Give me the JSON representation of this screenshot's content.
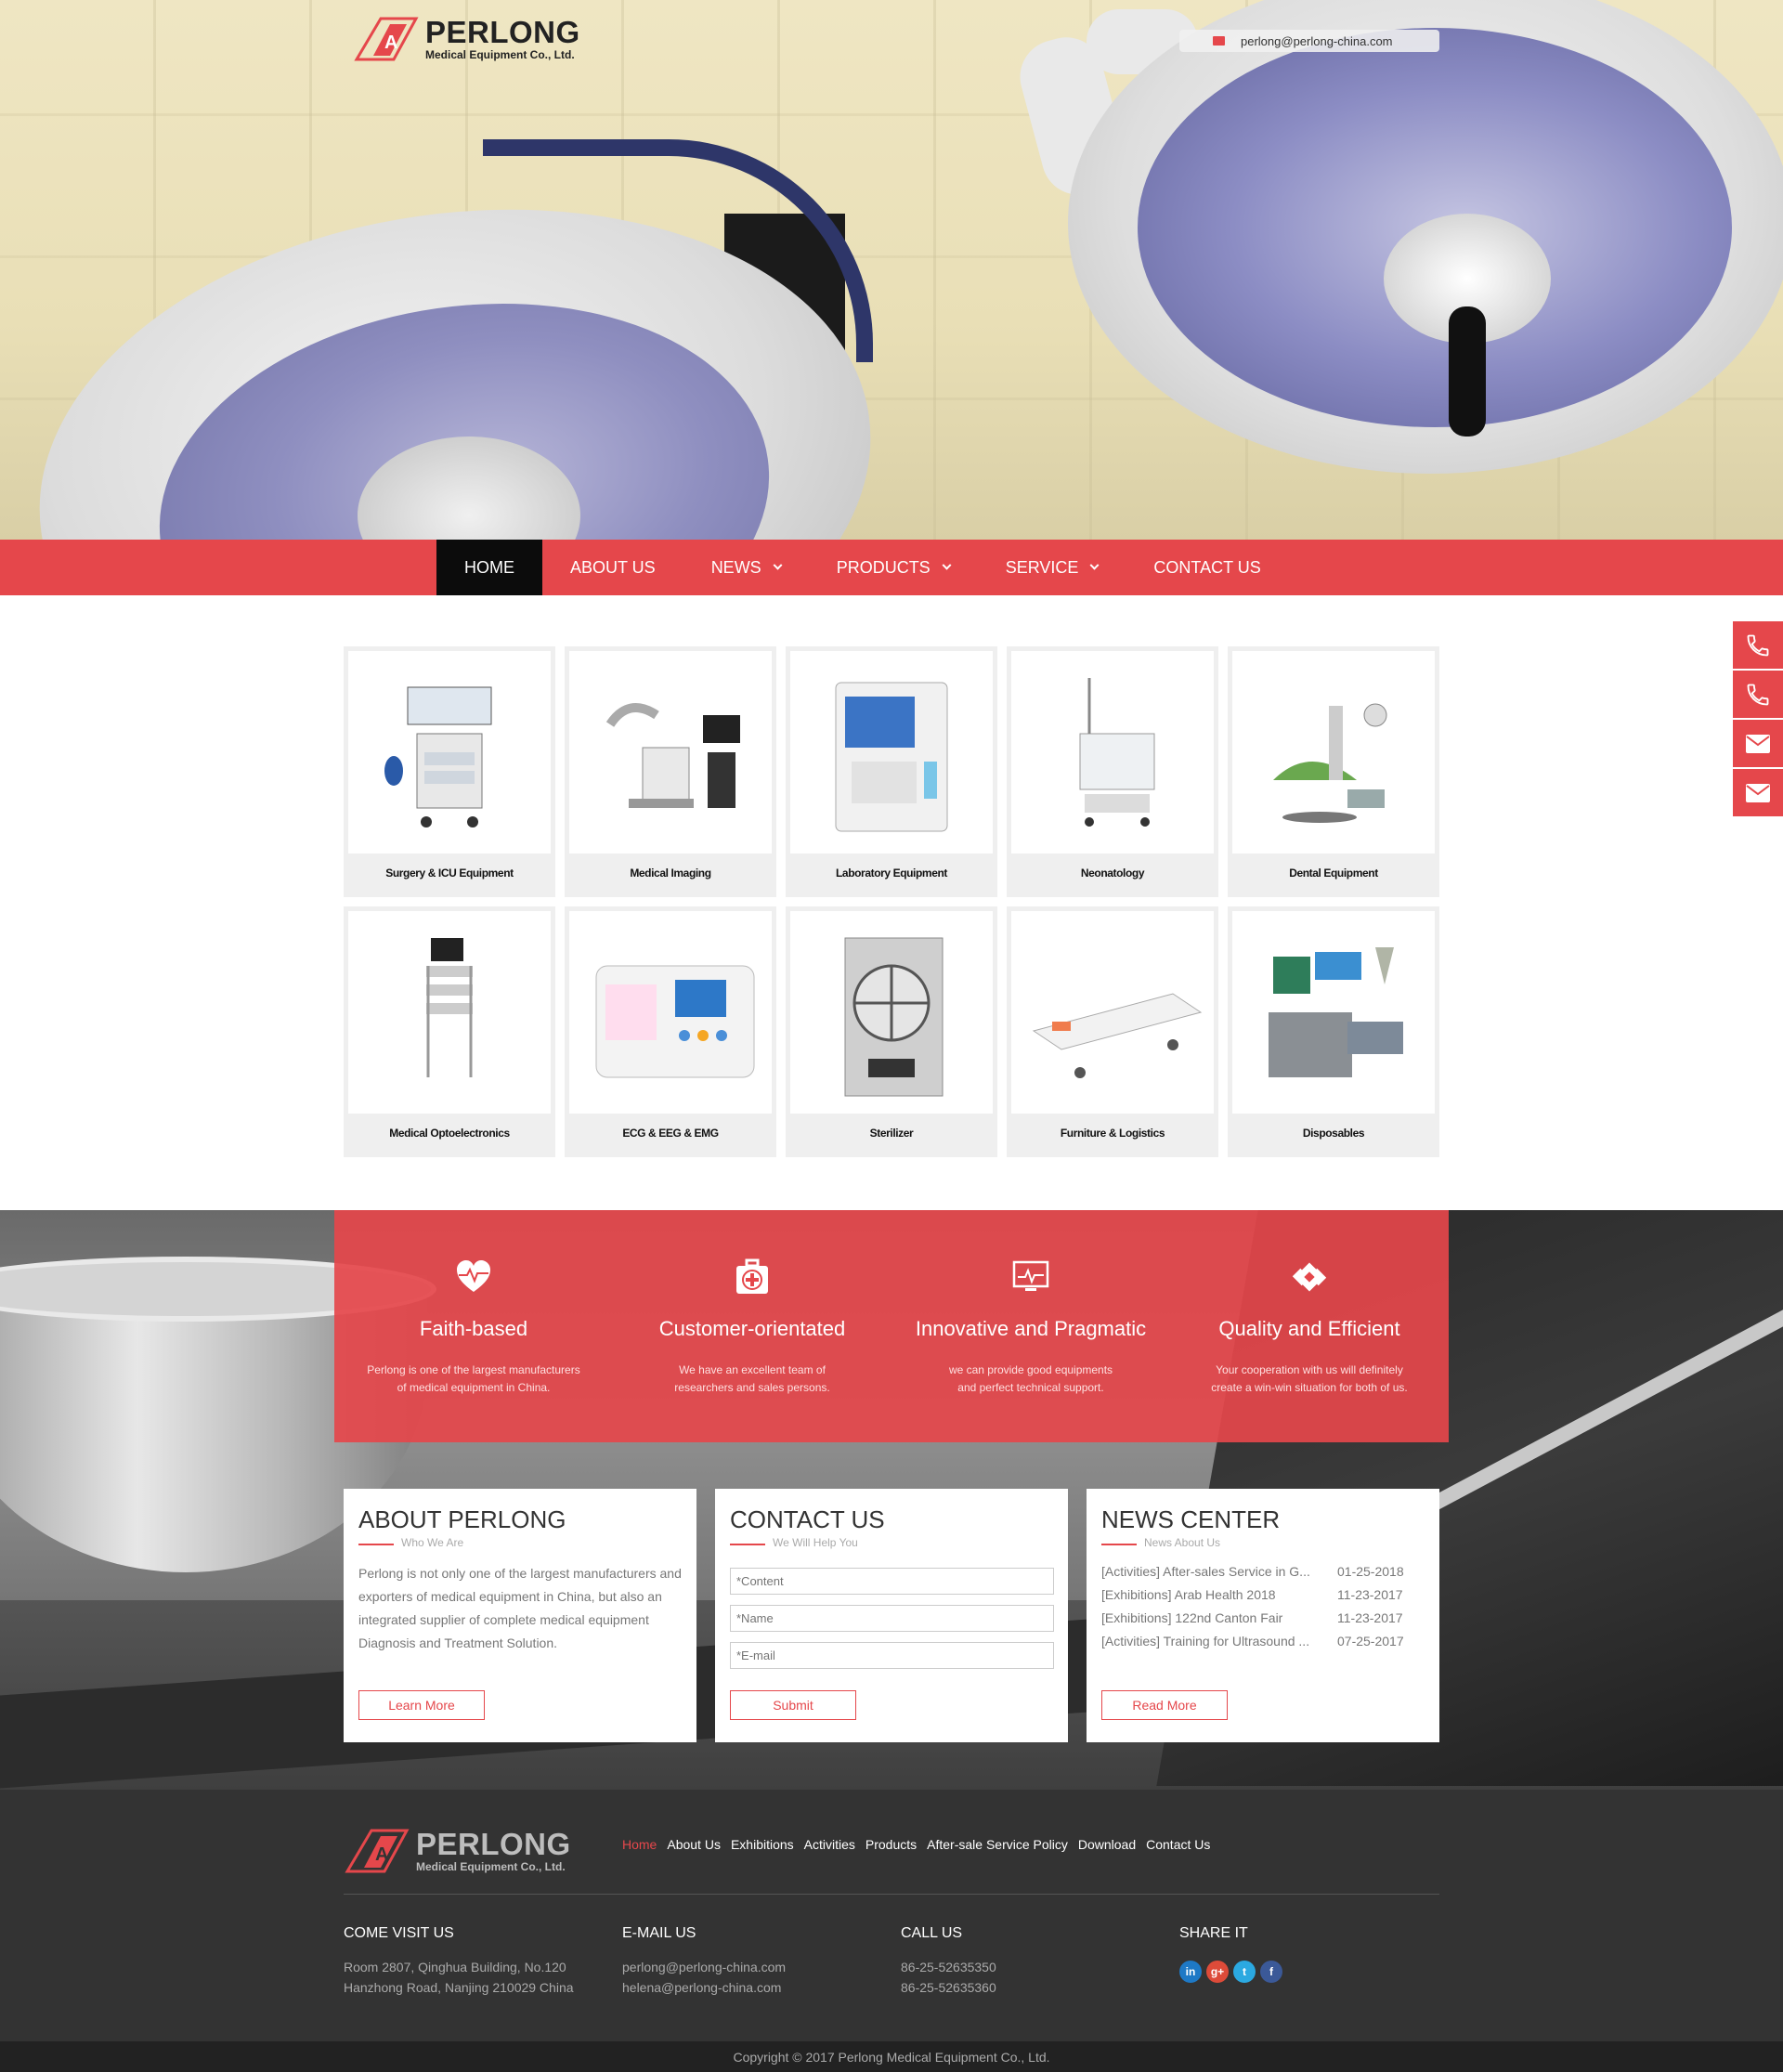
{
  "brand": {
    "name": "PERLONG",
    "subtitle": "Medical Equipment Co., Ltd.",
    "accent_color": "#e5474b"
  },
  "header": {
    "email": "perlong@perlong-china.com",
    "email_icon": "envelope-icon"
  },
  "nav": {
    "items": [
      {
        "label": "HOME",
        "active": true,
        "dropdown": false
      },
      {
        "label": "ABOUT US",
        "active": false,
        "dropdown": false
      },
      {
        "label": "NEWS",
        "active": false,
        "dropdown": true
      },
      {
        "label": "PRODUCTS",
        "active": false,
        "dropdown": true
      },
      {
        "label": "SERVICE",
        "active": false,
        "dropdown": true
      },
      {
        "label": "CONTACT US",
        "active": false,
        "dropdown": false
      }
    ]
  },
  "side_contact": {
    "icons": [
      "phone-icon",
      "phone-icon",
      "envelope-icon",
      "envelope-icon"
    ]
  },
  "products": {
    "items": [
      {
        "label": "Surgery & ICU Equipment"
      },
      {
        "label": "Medical Imaging"
      },
      {
        "label": "Laboratory Equipment"
      },
      {
        "label": "Neonatology"
      },
      {
        "label": "Dental Equipment"
      },
      {
        "label": "Medical Optoelectronics"
      },
      {
        "label": "ECG & EEG & EMG"
      },
      {
        "label": "Sterilizer"
      },
      {
        "label": "Furniture & Logistics"
      },
      {
        "label": "Disposables"
      }
    ]
  },
  "features": [
    {
      "icon": "heart-pulse-icon",
      "title": "Faith-based",
      "desc1": "Perlong is one of the largest manufacturers",
      "desc2": "of medical equipment in China."
    },
    {
      "icon": "medical-kit-icon",
      "title": "Customer-orientated",
      "desc1": "We have an excellent team of",
      "desc2": "researchers and sales persons."
    },
    {
      "icon": "monitor-icon",
      "title": "Innovative and Pragmatic",
      "desc1": "we can provide good equipments",
      "desc2": "and perfect technical support."
    },
    {
      "icon": "bandage-icon",
      "title": "Quality and Efficient",
      "desc1": "Your cooperation with us will definitely",
      "desc2": "create a win-win situation for both of us."
    }
  ],
  "about": {
    "title": "ABOUT PERLONG",
    "subtitle": "Who We Are",
    "text": "Perlong is not only one of the largest manufacturers and exporters of medical equipment in China, but also an integrated supplier of complete medical equipment Diagnosis and Treatment Solution.",
    "button": "Learn More"
  },
  "contact": {
    "title": "CONTACT US",
    "subtitle": "We Will Help You",
    "content_placeholder": "*Content",
    "name_placeholder": "*Name",
    "email_placeholder": "*E-mail",
    "button": "Submit"
  },
  "news": {
    "title": "NEWS CENTER",
    "subtitle": "News About Us",
    "items": [
      {
        "title": "[Activities] After-sales Service in G...",
        "date": "01-25-2018"
      },
      {
        "title": "[Exhibitions] Arab Health 2018",
        "date": "11-23-2017"
      },
      {
        "title": "[Exhibitions] 122nd Canton Fair",
        "date": "11-23-2017"
      },
      {
        "title": "[Activities] Training for Ultrasound ...",
        "date": "07-25-2017"
      }
    ],
    "button": "Read More"
  },
  "footer": {
    "links": [
      {
        "label": "Home",
        "active": true
      },
      {
        "label": "About Us",
        "active": false
      },
      {
        "label": "Exhibitions",
        "active": false
      },
      {
        "label": "Activities",
        "active": false
      },
      {
        "label": "Products",
        "active": false
      },
      {
        "label": "After-sale Service Policy",
        "active": false
      },
      {
        "label": "Download",
        "active": false
      },
      {
        "label": "Contact Us",
        "active": false
      }
    ],
    "visit": {
      "title": "COME VISIT US",
      "line1": "Room 2807, Qinghua Building, No.120",
      "line2": "Hanzhong Road, Nanjing 210029 China"
    },
    "email": {
      "title": "E-MAIL US",
      "line1": "perlong@perlong-china.com",
      "line2": "helena@perlong-china.com"
    },
    "call": {
      "title": "CALL US",
      "line1": "86-25-52635350",
      "line2": "86-25-52635360"
    },
    "share": {
      "title": "SHARE IT",
      "icons": [
        {
          "name": "linkedin-icon",
          "glyph": "in",
          "color": "#1e79c6"
        },
        {
          "name": "google-plus-icon",
          "glyph": "g+",
          "color": "#dd4b39"
        },
        {
          "name": "twitter-icon",
          "glyph": "t",
          "color": "#2ba9e1"
        },
        {
          "name": "facebook-icon",
          "glyph": "f",
          "color": "#3b5998"
        }
      ]
    },
    "copyright": "Copyright © 2017 Perlong Medical Equipment Co., Ltd."
  }
}
